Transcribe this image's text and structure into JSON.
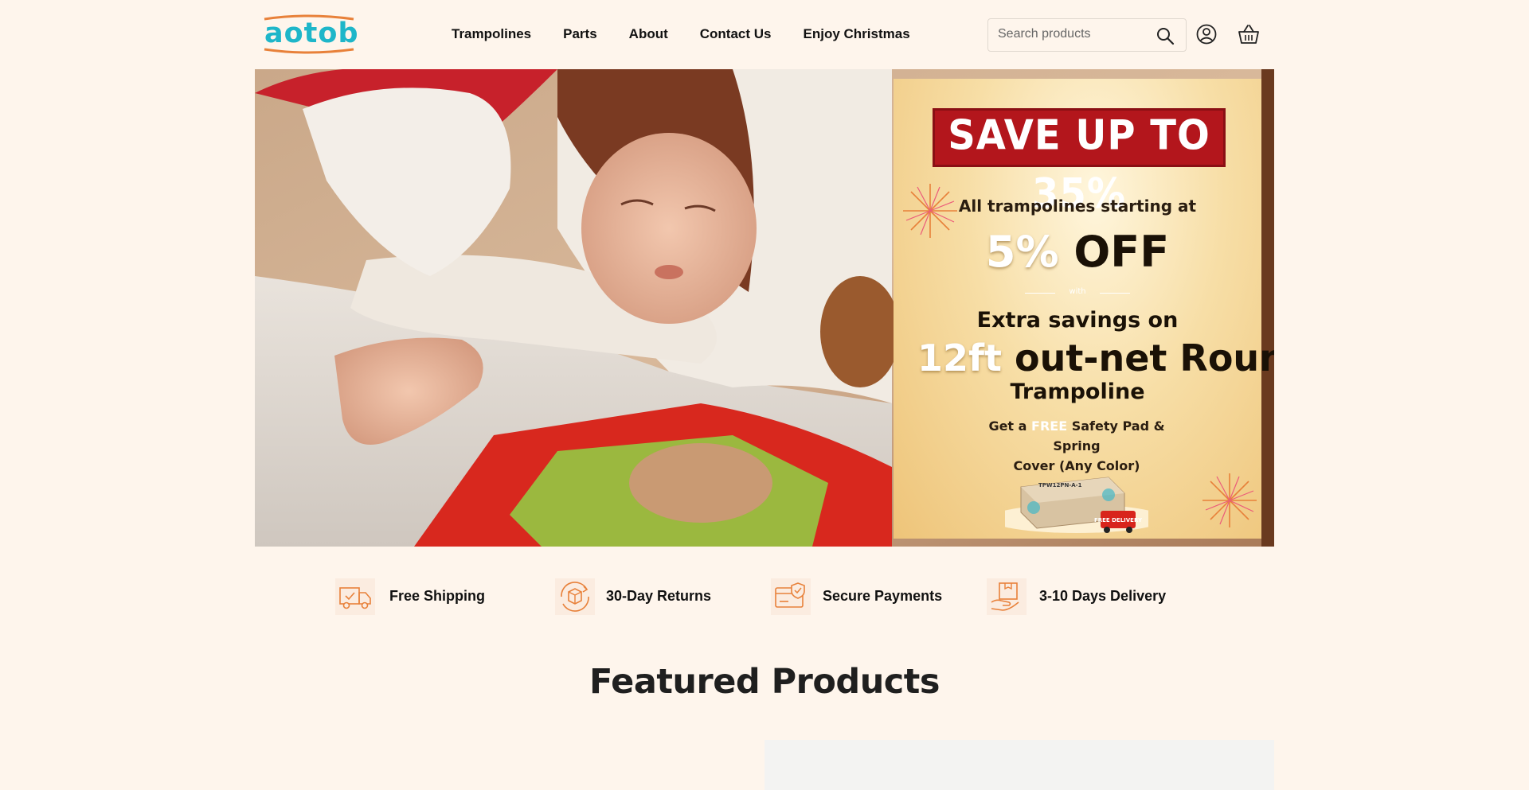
{
  "header": {
    "logo_text": "aotob",
    "nav": [
      "Trampolines",
      "Parts",
      "About",
      "Contact Us",
      "Enjoy Christmas"
    ],
    "search_placeholder": "Search products",
    "icons": [
      "search-icon",
      "account-icon",
      "cart-icon"
    ]
  },
  "hero": {
    "promo": {
      "banner": "SAVE UP TO 35%",
      "line1": "All trampolines starting at",
      "pct": "5%",
      "off": "OFF",
      "with": "with",
      "extra": "Extra savings on",
      "size": "12ft",
      "model": "out-net Round",
      "trampoline": "Trampoline",
      "free_pre": "Get a",
      "free_word": "FREE",
      "free_post": "Safety Pad & Spring",
      "free_line2": "Cover (Any Color)",
      "box_label": "TPW12PN-A-1",
      "delivery_badge": "FREE DELIVERY"
    }
  },
  "features": [
    {
      "label": "Free Shipping",
      "icon": "truck-icon"
    },
    {
      "label": "30-Day Returns",
      "icon": "returns-icon"
    },
    {
      "label": "Secure Payments",
      "icon": "secure-payment-icon"
    },
    {
      "label": "3-10 Days Delivery",
      "icon": "delivery-box-icon"
    }
  ],
  "featured": {
    "title": "Featured Products"
  },
  "colors": {
    "background": "#fef5ec",
    "accent_teal": "#1eb6c9",
    "accent_orange": "#e8813a",
    "promo_red": "#b3161c"
  }
}
